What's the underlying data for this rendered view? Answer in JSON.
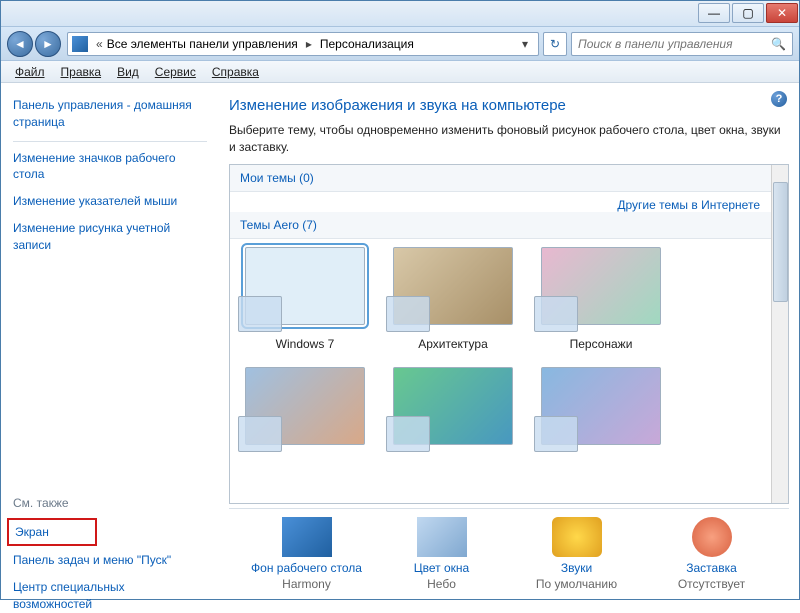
{
  "window": {
    "min": "—",
    "max": "▢",
    "close": "✕"
  },
  "nav": {
    "back": "◄",
    "fwd": "►",
    "chev": "«"
  },
  "breadcrumbs": {
    "part1": "Все элементы панели управления",
    "part2": "Персонализация"
  },
  "search": {
    "placeholder": "Поиск в панели управления"
  },
  "menu": {
    "file": "Файл",
    "edit": "Правка",
    "view": "Вид",
    "tools": "Сервис",
    "help": "Справка"
  },
  "sidebar": {
    "home": "Панель управления - домашняя страница",
    "links": [
      "Изменение значков рабочего стола",
      "Изменение указателей мыши",
      "Изменение рисунка учетной записи"
    ],
    "see_also": "См. также",
    "highlighted": "Экран",
    "bottom": [
      "Панель задач и меню \"Пуск\"",
      "Центр специальных возможностей"
    ]
  },
  "main": {
    "title": "Изменение изображения и звука на компьютере",
    "desc": "Выберите тему, чтобы одновременно изменить фоновый рисунок рабочего стола, цвет окна, звуки и заставку.",
    "section_my": "Мои темы (0)",
    "link_more": "Другие темы в Интернете",
    "section_aero": "Темы Aero (7)",
    "themes": [
      "Windows 7",
      "Архитектура",
      "Персонажи"
    ]
  },
  "actions": {
    "items": [
      {
        "title": "Фон рабочего стола",
        "sub": "Harmony"
      },
      {
        "title": "Цвет окна",
        "sub": "Небо"
      },
      {
        "title": "Звуки",
        "sub": "По умолчанию"
      },
      {
        "title": "Заставка",
        "sub": "Отсутствует"
      }
    ]
  }
}
